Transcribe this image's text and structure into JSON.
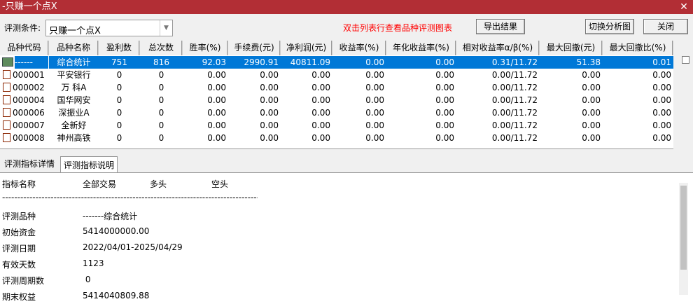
{
  "window": {
    "title": "-只赚一个点X",
    "close_icon": "close-icon"
  },
  "toolbar": {
    "condition_label": "评测条件:",
    "condition_value": "只赚一个点X",
    "hint": "双击列表行查看品种评测图表",
    "export": "导出结果",
    "switch": "切换分析图",
    "close": "关闭",
    "hint_color": "#ff0000"
  },
  "table": {
    "columns": [
      "品种代码",
      "品种名称",
      "盈利数",
      "总次数",
      "胜率(%)",
      "手续费(元)",
      "净利润(元)",
      "收益率(%)",
      "年化收益率(%)",
      "相对收益率α/β(%)",
      "最大回撤(元)",
      "最大回撤比(%)"
    ],
    "rows": [
      [
        "------",
        "综合统计",
        "751",
        "816",
        "92.03",
        "2990.91",
        "40811.09",
        "0.00",
        "0.00",
        "0.31/11.72",
        "51.38",
        "0.01"
      ],
      [
        "000001",
        "平安银行",
        "0",
        "0",
        "0.00",
        "0.00",
        "0.00",
        "0.00",
        "0.00",
        "0.00/11.72",
        "0.00",
        "0.00"
      ],
      [
        "000002",
        "万 科A",
        "0",
        "0",
        "0.00",
        "0.00",
        "0.00",
        "0.00",
        "0.00",
        "0.00/11.72",
        "0.00",
        "0.00"
      ],
      [
        "000004",
        "国华网安",
        "0",
        "0",
        "0.00",
        "0.00",
        "0.00",
        "0.00",
        "0.00",
        "0.00/11.72",
        "0.00",
        "0.00"
      ],
      [
        "000006",
        "深振业A",
        "0",
        "0",
        "0.00",
        "0.00",
        "0.00",
        "0.00",
        "0.00",
        "0.00/11.72",
        "0.00",
        "0.00"
      ],
      [
        "000007",
        "全新好",
        "0",
        "0",
        "0.00",
        "0.00",
        "0.00",
        "0.00",
        "0.00",
        "0.00/11.72",
        "0.00",
        "0.00"
      ],
      [
        "000008",
        "神州高铁",
        "0",
        "0",
        "0.00",
        "0.00",
        "0.00",
        "0.00",
        "0.00",
        "0.00/11.72",
        "0.00",
        "0.00"
      ]
    ]
  },
  "tabs": [
    "评测指标详情",
    "评测指标说明"
  ],
  "detail": {
    "headers": [
      "指标名称",
      "全部交易",
      "多头",
      "空头"
    ],
    "separator": "--------------------------------------------------------------------------------------",
    "items": [
      {
        "label": "评测品种",
        "value": "-------综合统计"
      },
      {
        "label": "初始资金",
        "value": "5414000000.00"
      },
      {
        "label": "评测日期",
        "value": "2022/04/01-2025/04/29"
      },
      {
        "label": "有效天数",
        "value": "1123"
      },
      {
        "label": "评测周期数",
        "value": " 0"
      },
      {
        "label": "期末权益",
        "value": "5414040809.88"
      }
    ]
  }
}
